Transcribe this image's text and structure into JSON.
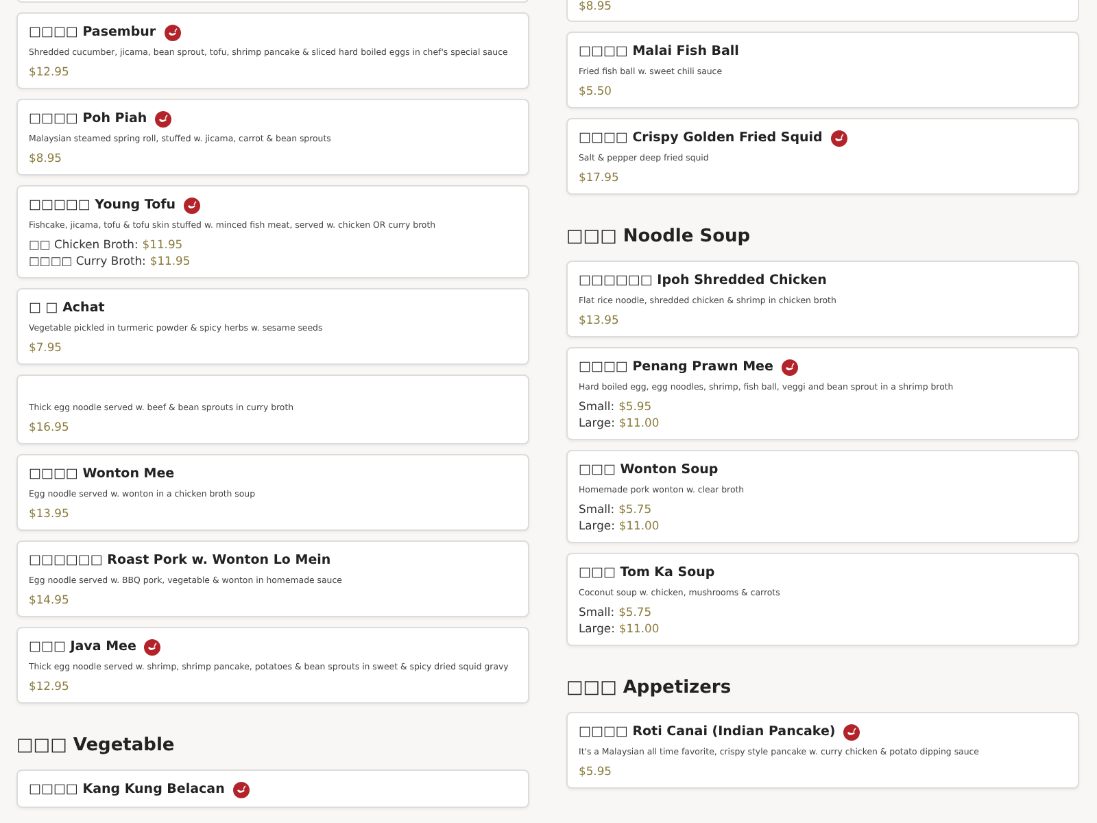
{
  "columns": [
    {
      "items": [
        {
          "kind": "partial"
        },
        {
          "kind": "item",
          "name": "□□□□ Pasembur",
          "spicy": true,
          "description": "Shredded cucumber, jicama, bean sprout, tofu, shrimp pancake & sliced hard boiled eggs in chef's special sauce",
          "prices": [
            {
              "price": "$12.95"
            }
          ]
        },
        {
          "kind": "item",
          "name": "□□□□ Poh Piah",
          "spicy": true,
          "description": "Malaysian steamed spring roll, stuffed w. jicama, carrot & bean sprouts",
          "prices": [
            {
              "price": "$8.95"
            }
          ]
        },
        {
          "kind": "item",
          "name": "□□□□□ Young Tofu",
          "spicy": true,
          "description": "Fishcake, jicama, tofu & tofu skin stuffed w. minced fish meat, served w. chicken OR curry broth",
          "prices": [
            {
              "label": "□□ Chicken Broth:",
              "price": "$11.95"
            },
            {
              "label": "□□□□ Curry Broth:",
              "price": "$11.95"
            }
          ]
        },
        {
          "kind": "item",
          "name": "□ □ Achat",
          "spicy": false,
          "description": "Vegetable pickled in turmeric powder & spicy herbs w. sesame seeds",
          "prices": [
            {
              "price": "$7.95"
            }
          ]
        },
        {
          "kind": "item",
          "description": "Thick egg noodle served w. beef & bean sprouts in curry broth",
          "prices": [
            {
              "price": "$16.95"
            }
          ]
        },
        {
          "kind": "item",
          "name": "□□□□ Wonton Mee",
          "spicy": false,
          "description": "Egg noodle served w. wonton in a chicken broth soup",
          "prices": [
            {
              "price": "$13.95"
            }
          ]
        },
        {
          "kind": "item",
          "name": "□□□□□□ Roast Pork w. Wonton Lo Mein",
          "spicy": false,
          "description": "Egg noodle served w. BBQ pork, vegetable & wonton in homemade sauce",
          "prices": [
            {
              "price": "$14.95"
            }
          ]
        },
        {
          "kind": "item",
          "name": "□□□ Java Mee",
          "spicy": true,
          "description": "Thick egg noodle served w. shrimp, shrimp pancake, potatoes & bean sprouts in sweet & spicy dried squid gravy",
          "prices": [
            {
              "price": "$12.95"
            }
          ]
        },
        {
          "kind": "heading",
          "title": "□□□ Vegetable"
        },
        {
          "kind": "item",
          "name": "□□□□ Kang Kung Belacan",
          "spicy": true
        }
      ]
    },
    {
      "items": [
        {
          "kind": "partial",
          "prices": [
            {
              "price": "$8.95"
            }
          ]
        },
        {
          "kind": "item",
          "name": "□□□□ Malai Fish Ball",
          "spicy": false,
          "description": "Fried fish ball w. sweet chili sauce",
          "prices": [
            {
              "price": "$5.50"
            }
          ]
        },
        {
          "kind": "item",
          "name": "□□□□ Crispy Golden Fried Squid",
          "spicy": true,
          "description": "Salt & pepper deep fried squid",
          "prices": [
            {
              "price": "$17.95"
            }
          ]
        },
        {
          "kind": "heading",
          "title": "□□□ Noodle Soup"
        },
        {
          "kind": "item",
          "name": "□□□□□□ Ipoh Shredded Chicken",
          "spicy": false,
          "description": "Flat rice noodle, shredded chicken & shrimp in chicken broth",
          "prices": [
            {
              "price": "$13.95"
            }
          ]
        },
        {
          "kind": "item",
          "name": "□□□□ Penang Prawn Mee",
          "spicy": true,
          "description": "Hard boiled egg, egg noodles, shrimp, fish ball, veggi and bean sprout in a shrimp broth",
          "prices": [
            {
              "label": "Small:",
              "price": "$5.95"
            },
            {
              "label": "Large:",
              "price": "$11.00"
            }
          ]
        },
        {
          "kind": "item",
          "name": "□□□ Wonton Soup",
          "spicy": false,
          "description": "Homemade pork wonton w. clear broth",
          "prices": [
            {
              "label": "Small:",
              "price": "$5.75"
            },
            {
              "label": "Large:",
              "price": "$11.00"
            }
          ]
        },
        {
          "kind": "item",
          "name": "□□□ Tom Ka Soup",
          "spicy": false,
          "description": "Coconut soup w. chicken, mushrooms & carrots",
          "prices": [
            {
              "label": "Small:",
              "price": "$5.75"
            },
            {
              "label": "Large:",
              "price": "$11.00"
            }
          ]
        },
        {
          "kind": "heading",
          "title": "□□□ Appetizers"
        },
        {
          "kind": "item",
          "name": "□□□□ Roti Canai (Indian Pancake)",
          "spicy": true,
          "description": "It's a Malaysian all time favorite, crispy style pancake w. curry chicken & potato dipping sauce",
          "prices": [
            {
              "price": "$5.95"
            }
          ]
        }
      ]
    }
  ]
}
